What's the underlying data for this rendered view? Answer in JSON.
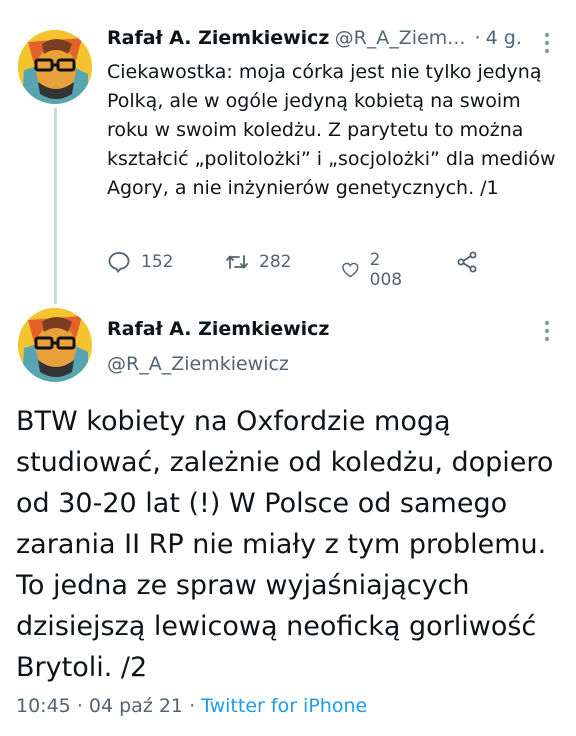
{
  "tweet1": {
    "author_name": "Rafał A. Ziemkiewicz",
    "author_handle": "@R_A_Ziem...",
    "time_separator": "·",
    "time": "4 g.",
    "text": "Ciekawostka: moja córka jest nie tylko jedyną Polką, ale w ogóle jedyną kobietą na swoim roku w swoim koledżu. Z parytetu to można kształcić „politolożki” i „socjolożki” dla mediów Agory, a nie inżynierów genetycznych. /1",
    "replies": "152",
    "retweets": "282",
    "likes": "2 008"
  },
  "tweet2": {
    "author_name": "Rafał A. Ziemkiewicz",
    "author_handle": "@R_A_Ziemkiewicz",
    "text": "BTW kobiety na Oxfordzie mogą studiować, zależnie od koledżu, dopiero od 30-20 lat (!) W Polsce od samego zarania II RP nie miały z tym problemu. To jedna ze spraw wyjaśniających dzisiejszą lewicową neoficką gorliwość Brytoli. /2",
    "time": "10:45",
    "separator1": "·",
    "date": "04 paź 21",
    "separator2": "·",
    "source": "Twitter for iPhone"
  },
  "colors": {
    "text_primary": "#0f1419",
    "text_secondary": "#536471",
    "link": "#1d9bf0",
    "thread_line": "#cfd9de"
  }
}
